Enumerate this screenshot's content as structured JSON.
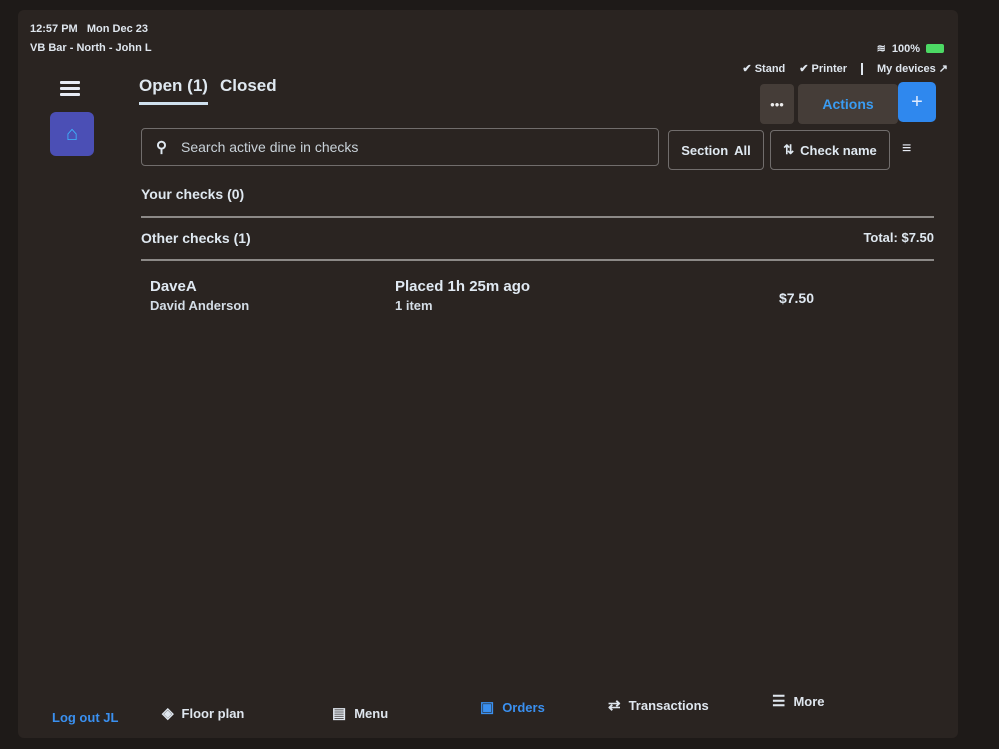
{
  "status_bar": {
    "time": "12:57 PM",
    "date": "Mon Dec 23",
    "location": "VB Bar - North - John L",
    "battery": "100%"
  },
  "devices": {
    "stand": "Stand",
    "printer": "Printer",
    "my_devices": "My devices"
  },
  "tabs": [
    {
      "label": "Open (1)",
      "active": true
    },
    {
      "label": "Closed",
      "active": false
    }
  ],
  "toolbar": {
    "more_label": "•••",
    "actions_label": "Actions",
    "add_label": "+"
  },
  "search": {
    "placeholder": "Search active dine in checks"
  },
  "filters": {
    "section_label": "Section",
    "section_value": "All",
    "sort_label": "Check name"
  },
  "groups": {
    "your_checks": "Your checks (0)",
    "other_checks": "Other checks (1)",
    "other_total": "Total: $7.50"
  },
  "checks": [
    {
      "name": "DaveA",
      "customer": "David Anderson",
      "placed": "Placed 1h 25m ago",
      "items": "1 item",
      "amount": "$7.50"
    }
  ],
  "bottom_nav": {
    "logout": "Log out JL",
    "items": [
      {
        "label": "Floor plan",
        "icon": "floor-plan-icon",
        "active": false
      },
      {
        "label": "Menu",
        "icon": "menu-book-icon",
        "active": false
      },
      {
        "label": "Orders",
        "icon": "orders-icon",
        "active": true
      },
      {
        "label": "Transactions",
        "icon": "transactions-icon",
        "active": false
      },
      {
        "label": "More",
        "icon": "more-list-icon",
        "active": false
      }
    ]
  },
  "colors": {
    "accent": "#3a90f0",
    "add_button": "#2f88ee",
    "sidebar_tile": "#4b4fb5",
    "battery": "#4cd964"
  }
}
